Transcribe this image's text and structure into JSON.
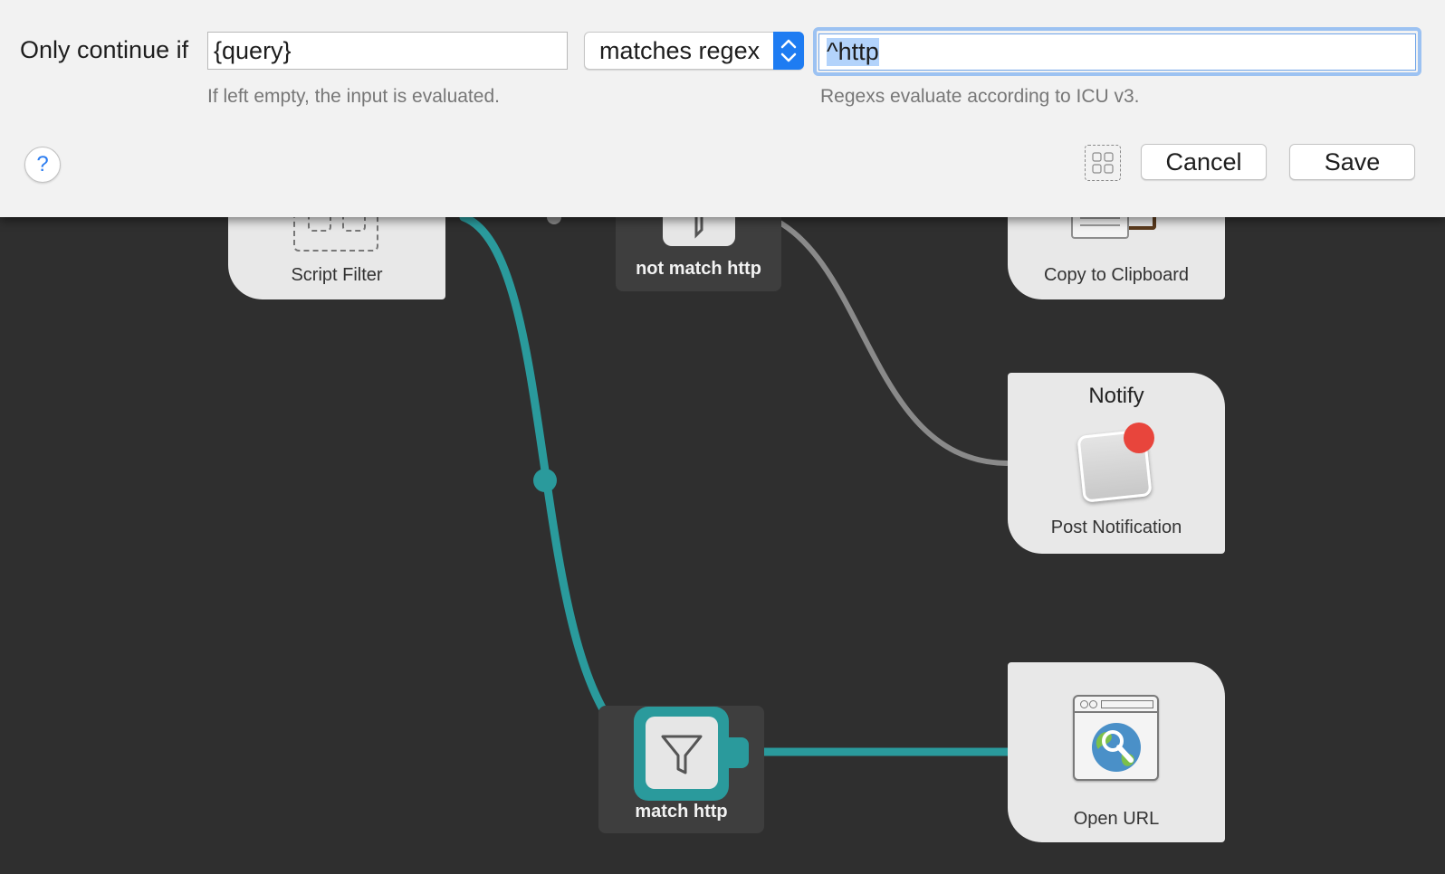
{
  "dialog": {
    "condition_label": "Only continue if",
    "input_field": {
      "value": "{query}",
      "hint": "If left empty, the input is evaluated."
    },
    "operator": {
      "selected": "matches regex"
    },
    "regex_field": {
      "value": "^http",
      "hint": "Regexs evaluate according to ICU v3."
    },
    "help_label": "?",
    "cancel_label": "Cancel",
    "save_label": "Save"
  },
  "workflow": {
    "nodes": {
      "script_filter": {
        "label": "Script Filter"
      },
      "not_match_filter": {
        "label": "not match http"
      },
      "copy_clipboard": {
        "label": "Copy to Clipboard"
      },
      "notify": {
        "title": "Notify",
        "label": "Post Notification"
      },
      "match_filter": {
        "label": "match http"
      },
      "open_url": {
        "label": "Open URL"
      }
    },
    "colors": {
      "canvas": "#2f2f2f",
      "active_wire": "#2a9a9c",
      "inactive_wire": "#8a8a8a",
      "selection_accent": "#2a9a9c",
      "notification_badge": "#e8453c"
    }
  }
}
